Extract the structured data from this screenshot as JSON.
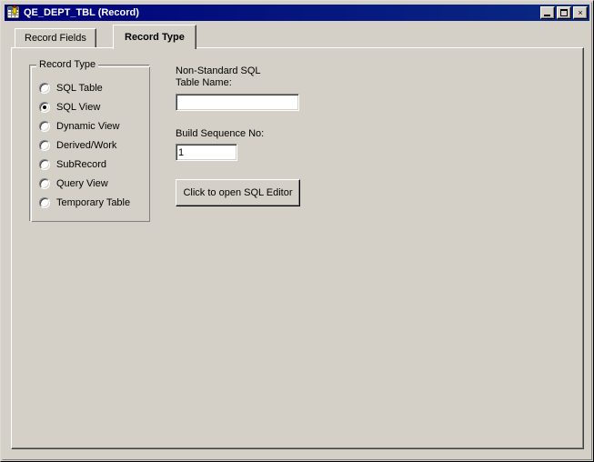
{
  "window": {
    "title": "QE_DEPT_TBL (Record)",
    "icon": "record-table-icon",
    "titlebar_color": "#00007b",
    "face_color": "#d4d0c8",
    "controls": {
      "minimize_label": "Minimize",
      "maximize_label": "Maximize",
      "close_label": "×"
    }
  },
  "tabs": [
    {
      "label": "Record Fields",
      "active": false
    },
    {
      "label": "Record Type",
      "active": true
    }
  ],
  "record_type_group": {
    "title": "Record Type",
    "selected": "SQL View",
    "options": [
      {
        "label": "SQL Table",
        "checked": false
      },
      {
        "label": "SQL View",
        "checked": true
      },
      {
        "label": "Dynamic View",
        "checked": false
      },
      {
        "label": "Derived/Work",
        "checked": false
      },
      {
        "label": "SubRecord",
        "checked": false
      },
      {
        "label": "Query View",
        "checked": false
      },
      {
        "label": "Temporary Table",
        "checked": false
      }
    ]
  },
  "fields": {
    "sql_table_name": {
      "label": "Non-Standard SQL\nTable Name:",
      "value": "",
      "placeholder": ""
    },
    "build_sequence": {
      "label": "Build Sequence No:",
      "value": "1",
      "placeholder": ""
    }
  },
  "actions": {
    "open_sql_editor": "Click to open SQL Editor"
  }
}
